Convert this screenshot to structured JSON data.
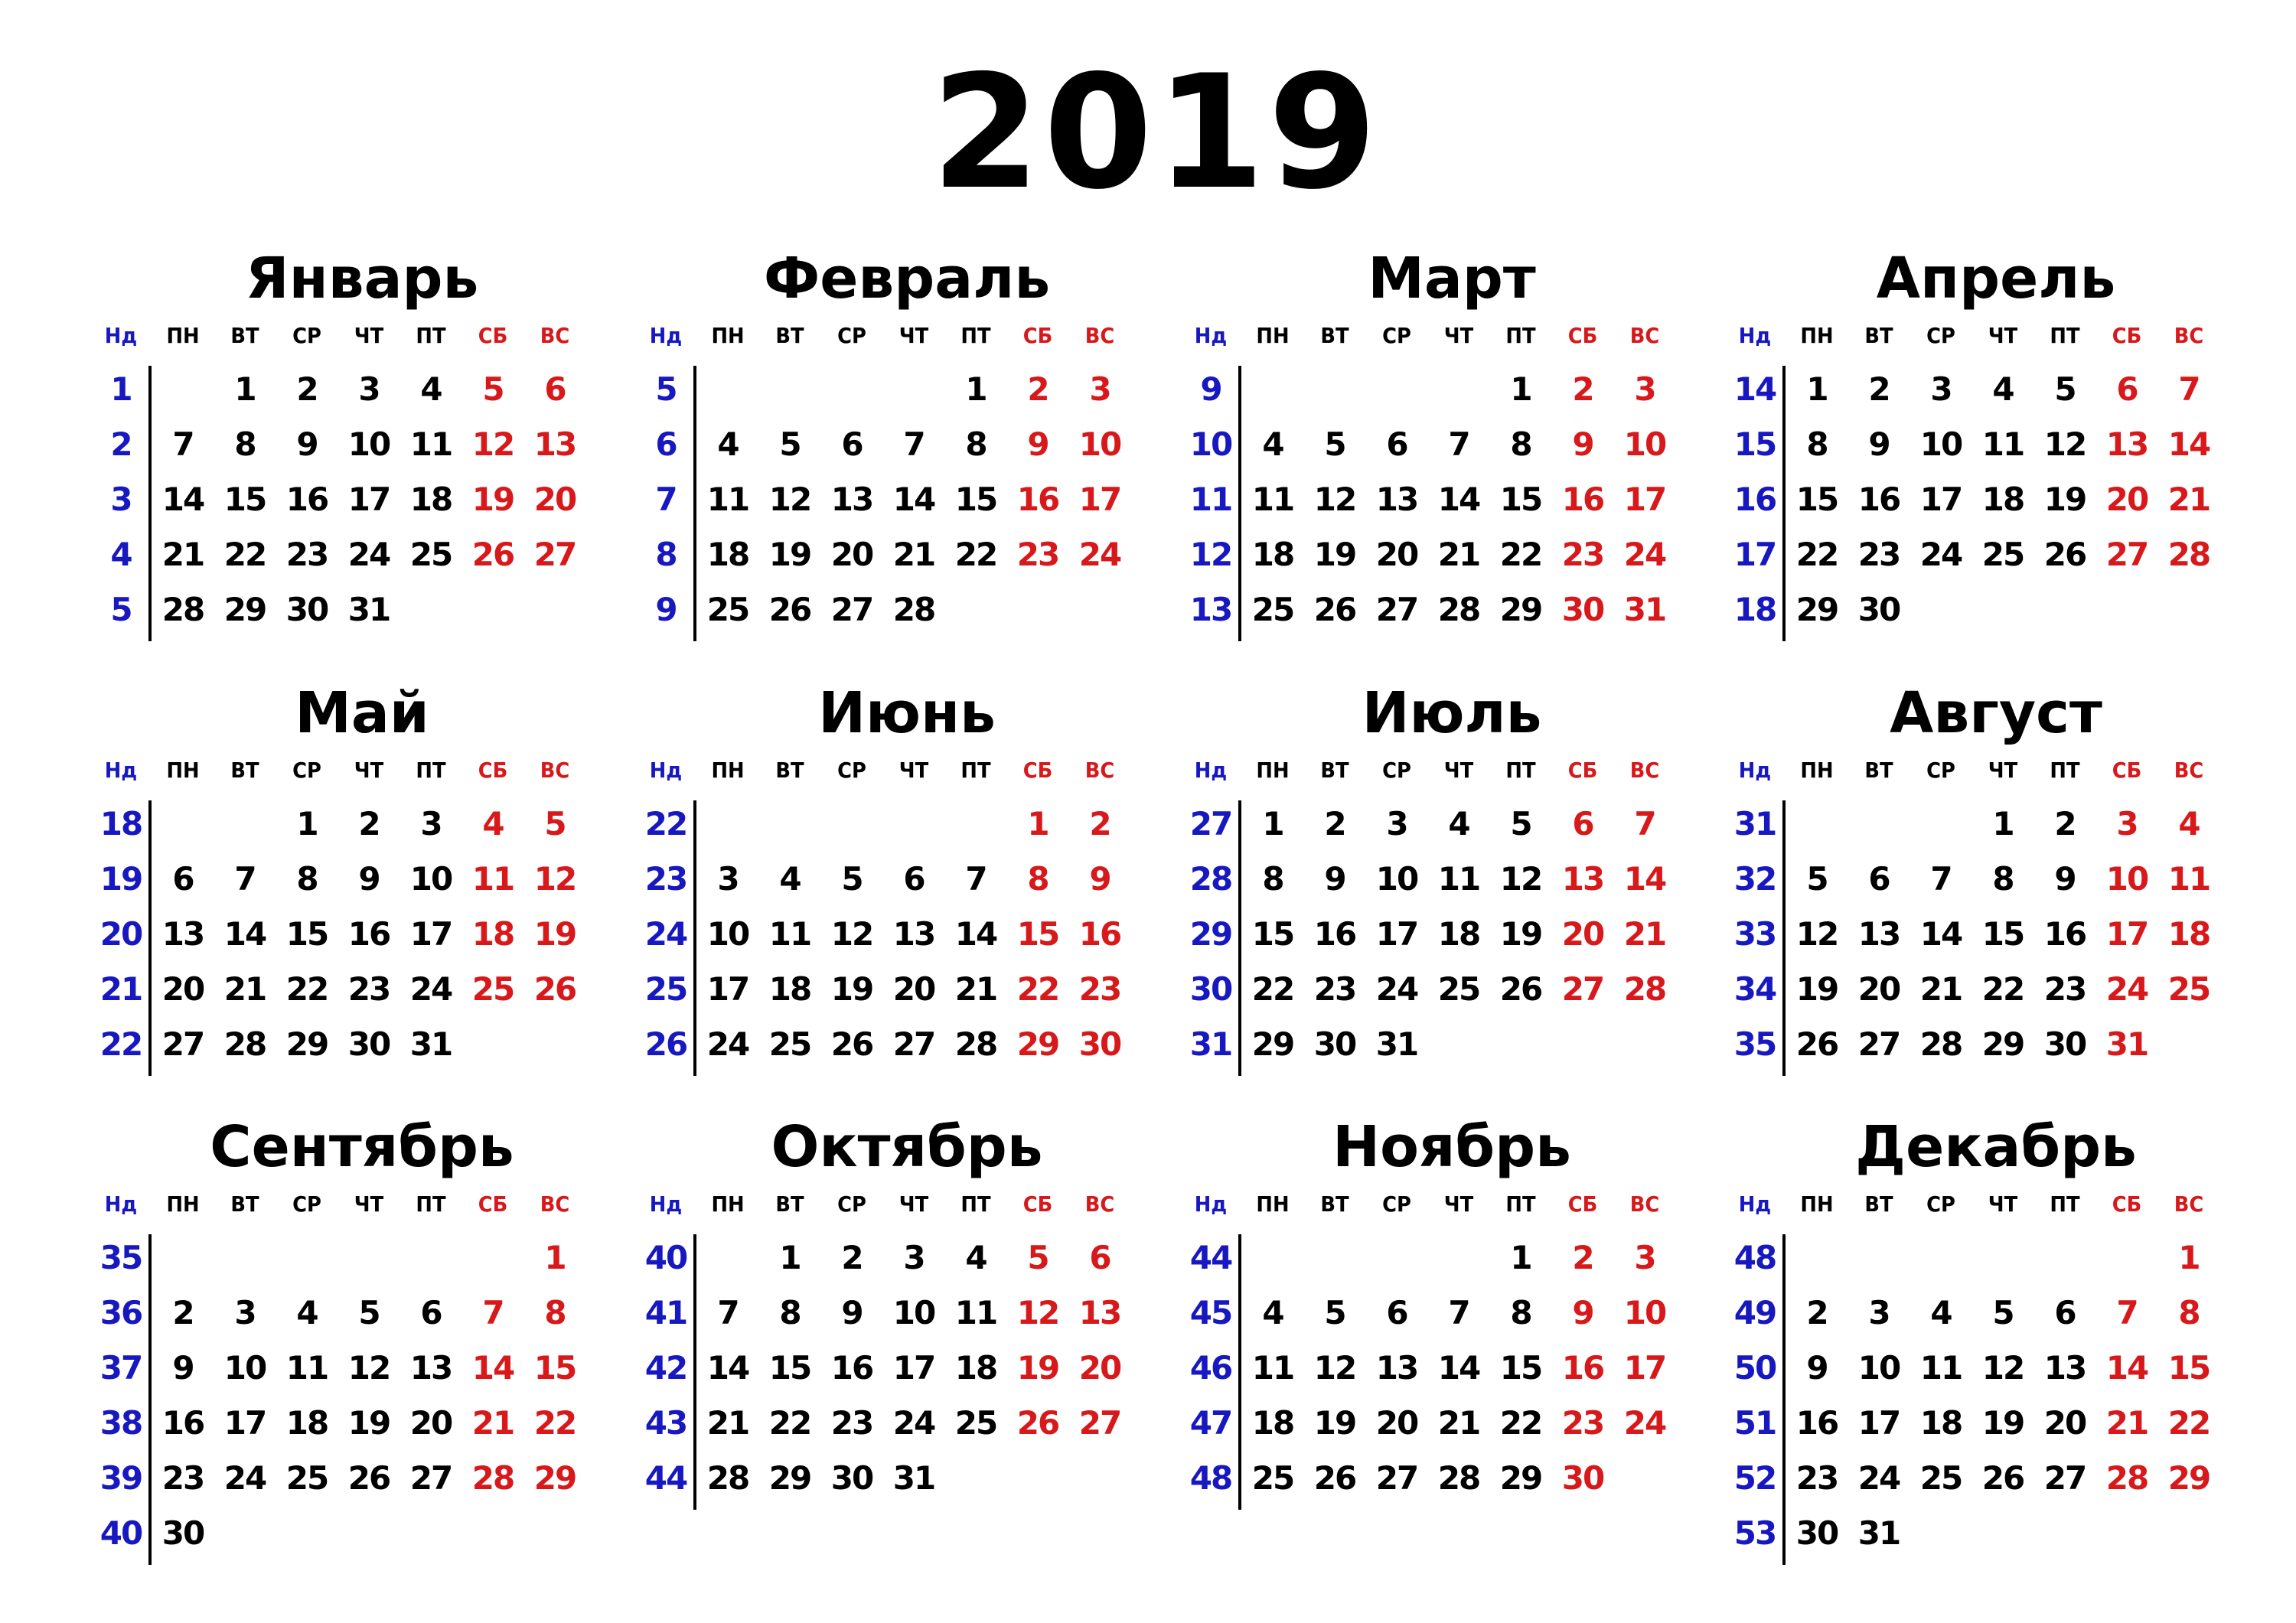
{
  "title": "2019",
  "colors": {
    "week_number": "#1818c0",
    "weekend": "#d8191b",
    "weekday": "#000000"
  },
  "weekday_headers": [
    {
      "label": "Нд",
      "kind": "week"
    },
    {
      "label": "ПН",
      "kind": "day"
    },
    {
      "label": "ВТ",
      "kind": "day"
    },
    {
      "label": "СР",
      "kind": "day"
    },
    {
      "label": "ЧТ",
      "kind": "day"
    },
    {
      "label": "ПТ",
      "kind": "day"
    },
    {
      "label": "СБ",
      "kind": "weekend"
    },
    {
      "label": "ВС",
      "kind": "weekend"
    }
  ],
  "months": [
    {
      "name": "Январь",
      "weeks": [
        {
          "no": 1,
          "days": [
            null,
            1,
            2,
            3,
            4,
            5,
            6
          ]
        },
        {
          "no": 2,
          "days": [
            7,
            8,
            9,
            10,
            11,
            12,
            13
          ]
        },
        {
          "no": 3,
          "days": [
            14,
            15,
            16,
            17,
            18,
            19,
            20
          ]
        },
        {
          "no": 4,
          "days": [
            21,
            22,
            23,
            24,
            25,
            26,
            27
          ]
        },
        {
          "no": 5,
          "days": [
            28,
            29,
            30,
            31,
            null,
            null,
            null
          ]
        }
      ]
    },
    {
      "name": "Февраль",
      "weeks": [
        {
          "no": 5,
          "days": [
            null,
            null,
            null,
            null,
            1,
            2,
            3
          ]
        },
        {
          "no": 6,
          "days": [
            4,
            5,
            6,
            7,
            8,
            9,
            10
          ]
        },
        {
          "no": 7,
          "days": [
            11,
            12,
            13,
            14,
            15,
            16,
            17
          ]
        },
        {
          "no": 8,
          "days": [
            18,
            19,
            20,
            21,
            22,
            23,
            24
          ]
        },
        {
          "no": 9,
          "days": [
            25,
            26,
            27,
            28,
            null,
            null,
            null
          ]
        }
      ]
    },
    {
      "name": "Март",
      "weeks": [
        {
          "no": 9,
          "days": [
            null,
            null,
            null,
            null,
            1,
            2,
            3
          ]
        },
        {
          "no": 10,
          "days": [
            4,
            5,
            6,
            7,
            8,
            9,
            10
          ]
        },
        {
          "no": 11,
          "days": [
            11,
            12,
            13,
            14,
            15,
            16,
            17
          ]
        },
        {
          "no": 12,
          "days": [
            18,
            19,
            20,
            21,
            22,
            23,
            24
          ]
        },
        {
          "no": 13,
          "days": [
            25,
            26,
            27,
            28,
            29,
            30,
            31
          ]
        }
      ]
    },
    {
      "name": "Апрель",
      "weeks": [
        {
          "no": 14,
          "days": [
            1,
            2,
            3,
            4,
            5,
            6,
            7
          ]
        },
        {
          "no": 15,
          "days": [
            8,
            9,
            10,
            11,
            12,
            13,
            14
          ]
        },
        {
          "no": 16,
          "days": [
            15,
            16,
            17,
            18,
            19,
            20,
            21
          ]
        },
        {
          "no": 17,
          "days": [
            22,
            23,
            24,
            25,
            26,
            27,
            28
          ]
        },
        {
          "no": 18,
          "days": [
            29,
            30,
            null,
            null,
            null,
            null,
            null
          ]
        }
      ]
    },
    {
      "name": "Май",
      "weeks": [
        {
          "no": 18,
          "days": [
            null,
            null,
            1,
            2,
            3,
            4,
            5
          ]
        },
        {
          "no": 19,
          "days": [
            6,
            7,
            8,
            9,
            10,
            11,
            12
          ]
        },
        {
          "no": 20,
          "days": [
            13,
            14,
            15,
            16,
            17,
            18,
            19
          ]
        },
        {
          "no": 21,
          "days": [
            20,
            21,
            22,
            23,
            24,
            25,
            26
          ]
        },
        {
          "no": 22,
          "days": [
            27,
            28,
            29,
            30,
            31,
            null,
            null
          ]
        }
      ]
    },
    {
      "name": "Июнь",
      "weeks": [
        {
          "no": 22,
          "days": [
            null,
            null,
            null,
            null,
            null,
            1,
            2
          ]
        },
        {
          "no": 23,
          "days": [
            3,
            4,
            5,
            6,
            7,
            8,
            9
          ]
        },
        {
          "no": 24,
          "days": [
            10,
            11,
            12,
            13,
            14,
            15,
            16
          ]
        },
        {
          "no": 25,
          "days": [
            17,
            18,
            19,
            20,
            21,
            22,
            23
          ]
        },
        {
          "no": 26,
          "days": [
            24,
            25,
            26,
            27,
            28,
            29,
            30
          ]
        }
      ]
    },
    {
      "name": "Июль",
      "weeks": [
        {
          "no": 27,
          "days": [
            1,
            2,
            3,
            4,
            5,
            6,
            7
          ]
        },
        {
          "no": 28,
          "days": [
            8,
            9,
            10,
            11,
            12,
            13,
            14
          ]
        },
        {
          "no": 29,
          "days": [
            15,
            16,
            17,
            18,
            19,
            20,
            21
          ]
        },
        {
          "no": 30,
          "days": [
            22,
            23,
            24,
            25,
            26,
            27,
            28
          ]
        },
        {
          "no": 31,
          "days": [
            29,
            30,
            31,
            null,
            null,
            null,
            null
          ]
        }
      ]
    },
    {
      "name": "Август",
      "weeks": [
        {
          "no": 31,
          "days": [
            null,
            null,
            null,
            1,
            2,
            3,
            4
          ]
        },
        {
          "no": 32,
          "days": [
            5,
            6,
            7,
            8,
            9,
            10,
            11
          ]
        },
        {
          "no": 33,
          "days": [
            12,
            13,
            14,
            15,
            16,
            17,
            18
          ]
        },
        {
          "no": 34,
          "days": [
            19,
            20,
            21,
            22,
            23,
            24,
            25
          ]
        },
        {
          "no": 35,
          "days": [
            26,
            27,
            28,
            29,
            30,
            31,
            null
          ]
        }
      ]
    },
    {
      "name": "Сентябрь",
      "weeks": [
        {
          "no": 35,
          "days": [
            null,
            null,
            null,
            null,
            null,
            null,
            1
          ]
        },
        {
          "no": 36,
          "days": [
            2,
            3,
            4,
            5,
            6,
            7,
            8
          ]
        },
        {
          "no": 37,
          "days": [
            9,
            10,
            11,
            12,
            13,
            14,
            15
          ]
        },
        {
          "no": 38,
          "days": [
            16,
            17,
            18,
            19,
            20,
            21,
            22
          ]
        },
        {
          "no": 39,
          "days": [
            23,
            24,
            25,
            26,
            27,
            28,
            29
          ]
        },
        {
          "no": 40,
          "days": [
            30,
            null,
            null,
            null,
            null,
            null,
            null
          ]
        }
      ]
    },
    {
      "name": "Октябрь",
      "weeks": [
        {
          "no": 40,
          "days": [
            null,
            1,
            2,
            3,
            4,
            5,
            6
          ]
        },
        {
          "no": 41,
          "days": [
            7,
            8,
            9,
            10,
            11,
            12,
            13
          ]
        },
        {
          "no": 42,
          "days": [
            14,
            15,
            16,
            17,
            18,
            19,
            20
          ]
        },
        {
          "no": 43,
          "days": [
            21,
            22,
            23,
            24,
            25,
            26,
            27
          ]
        },
        {
          "no": 44,
          "days": [
            28,
            29,
            30,
            31,
            null,
            null,
            null
          ]
        }
      ]
    },
    {
      "name": "Ноябрь",
      "weeks": [
        {
          "no": 44,
          "days": [
            null,
            null,
            null,
            null,
            1,
            2,
            3
          ]
        },
        {
          "no": 45,
          "days": [
            4,
            5,
            6,
            7,
            8,
            9,
            10
          ]
        },
        {
          "no": 46,
          "days": [
            11,
            12,
            13,
            14,
            15,
            16,
            17
          ]
        },
        {
          "no": 47,
          "days": [
            18,
            19,
            20,
            21,
            22,
            23,
            24
          ]
        },
        {
          "no": 48,
          "days": [
            25,
            26,
            27,
            28,
            29,
            30,
            null
          ]
        }
      ]
    },
    {
      "name": "Декабрь",
      "weeks": [
        {
          "no": 48,
          "days": [
            null,
            null,
            null,
            null,
            null,
            null,
            1
          ]
        },
        {
          "no": 49,
          "days": [
            2,
            3,
            4,
            5,
            6,
            7,
            8
          ]
        },
        {
          "no": 50,
          "days": [
            9,
            10,
            11,
            12,
            13,
            14,
            15
          ]
        },
        {
          "no": 51,
          "days": [
            16,
            17,
            18,
            19,
            20,
            21,
            22
          ]
        },
        {
          "no": 52,
          "days": [
            23,
            24,
            25,
            26,
            27,
            28,
            29
          ]
        },
        {
          "no": 53,
          "days": [
            30,
            31,
            null,
            null,
            null,
            null,
            null
          ]
        }
      ]
    }
  ]
}
